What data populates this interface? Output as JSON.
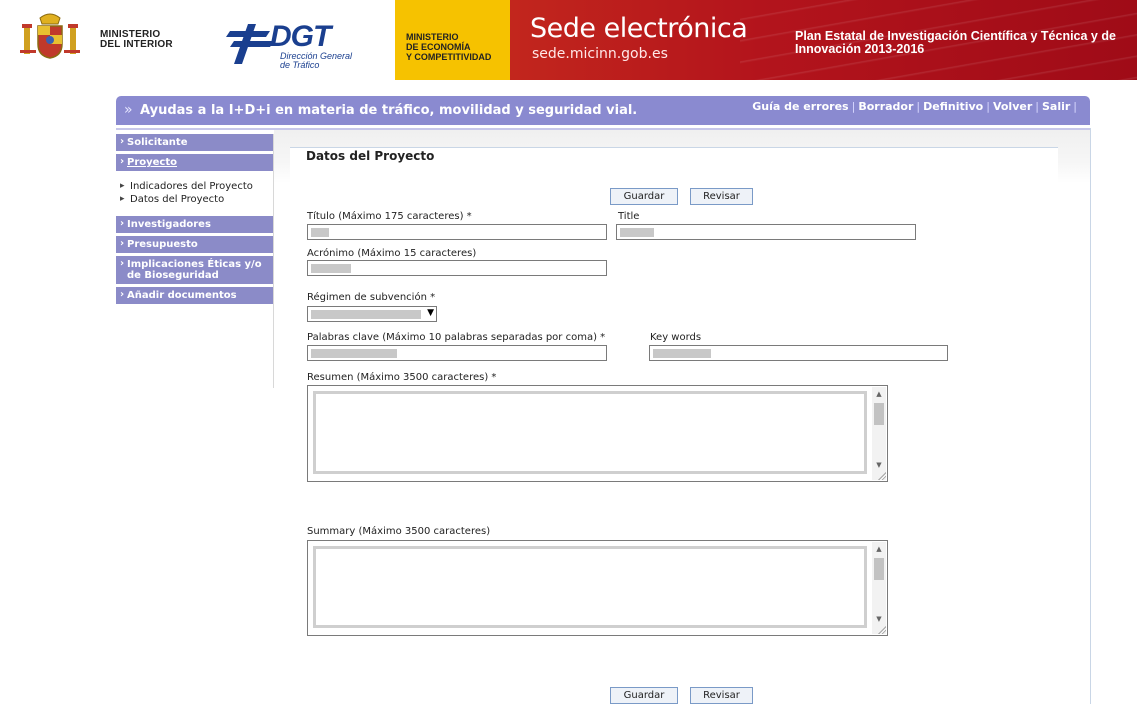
{
  "header": {
    "ministerio_interior": [
      "MINISTERIO",
      "DEL INTERIOR"
    ],
    "dgt_logo_text": "DGT",
    "dgt_subtitle": [
      "Dirección General",
      "de Tráfico"
    ],
    "ministerio_economia": [
      "MINISTERIO",
      "DE ECONOMÍA",
      "Y COMPETITIVIDAD"
    ],
    "sede_title": "Sede electrónica",
    "sede_url": "sede.micinn.gob.es",
    "plan_text": [
      "Plan Estatal de Investigación Científica y Técnica y de",
      "Innovación 2013-2016"
    ]
  },
  "titlebar": {
    "chevron": "»",
    "title": "Ayudas a la I+D+i en materia de tráfico, movilidad y seguridad vial.",
    "links": [
      "Guía de errores",
      "Borrador",
      "Definitivo",
      "Volver",
      "Salir"
    ],
    "separator": "|"
  },
  "nav": {
    "items": [
      {
        "label": "Solicitante"
      },
      {
        "label": "Proyecto"
      },
      {
        "label": "Investigadores"
      },
      {
        "label": "Presupuesto"
      },
      {
        "label": "Implicaciones Éticas y/o de Bioseguridad"
      },
      {
        "label": "Añadir documentos"
      }
    ],
    "subitems": [
      "Indicadores del Proyecto",
      "Datos del Proyecto"
    ]
  },
  "main": {
    "title": "Datos del Proyecto",
    "buttons": {
      "save": "Guardar",
      "review": "Revisar"
    },
    "fields": {
      "titulo": "Título (Máximo 175 caracteres) *",
      "title_en": "Title",
      "acronimo": "Acrónimo (Máximo 15 caracteres)",
      "regimen": "Régimen de subvención *",
      "palabras": "Palabras clave (Máximo 10 palabras separadas por coma) *",
      "keywords": "Key words",
      "resumen": "Resumen (Máximo 3500 caracteres) *",
      "summary": "Summary (Máximo 3500 caracteres)"
    },
    "select_arrow": "▼",
    "scroll_up": "▲",
    "scroll_down": "▼"
  },
  "colors": {
    "titlebar": "#8a8ad0",
    "nav": "#8b8bc8",
    "banner_yellow": "#f6c200",
    "banner_red": "#b3141c"
  }
}
